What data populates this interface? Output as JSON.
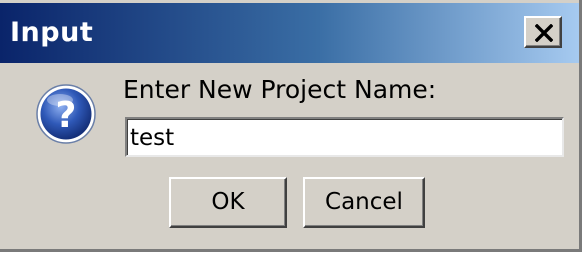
{
  "window": {
    "title": "Input",
    "close_symbol": "×",
    "close_icon": "close-icon"
  },
  "dialog": {
    "icon": "question-icon",
    "prompt": "Enter New Project Name:",
    "input_value": "test"
  },
  "buttons": {
    "ok_label": "OK",
    "cancel_label": "Cancel"
  },
  "colors": {
    "title_gradient_start": "#0a246a",
    "title_gradient_end": "#a6caf0",
    "dialog_background": "#d4d0c8",
    "icon_blue": "#2f59b8"
  }
}
